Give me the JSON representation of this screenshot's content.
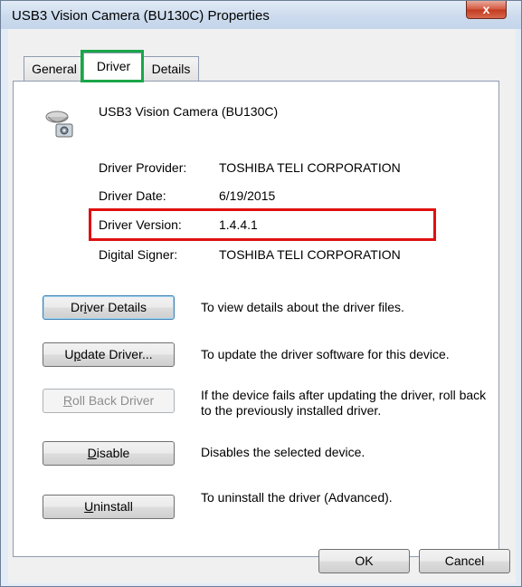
{
  "window": {
    "title": "USB3 Vision Camera (BU130C) Properties",
    "close_glyph": "x"
  },
  "tabs": [
    {
      "label": "General",
      "active": false
    },
    {
      "label": "Driver",
      "active": true
    },
    {
      "label": "Details",
      "active": false
    }
  ],
  "device": {
    "icon": "camera-icon",
    "name": "USB3 Vision Camera (BU130C)"
  },
  "info": {
    "provider_label": "Driver Provider:",
    "provider_value": "TOSHIBA TELI CORPORATION",
    "date_label": "Driver Date:",
    "date_value": "6/19/2015",
    "version_label": "Driver Version:",
    "version_value": "1.4.4.1",
    "signer_label": "Digital Signer:",
    "signer_value": "TOSHIBA TELI CORPORATION"
  },
  "actions": {
    "details": {
      "pre": "Dr",
      "key": "i",
      "post": "ver Details",
      "desc": "To view details about the driver files."
    },
    "update": {
      "pre": "U",
      "key": "p",
      "post": "date Driver...",
      "desc": "To update the driver software for this device."
    },
    "rollback": {
      "pre": "",
      "key": "R",
      "post": "oll Back Driver",
      "desc": "If the device fails after updating the driver, roll back to the previously installed driver."
    },
    "disable": {
      "pre": "",
      "key": "D",
      "post": "isable",
      "desc": "Disables the selected device."
    },
    "uninstall": {
      "pre": "",
      "key": "U",
      "post": "ninstall",
      "desc": "To uninstall the driver (Advanced)."
    }
  },
  "footer": {
    "ok_label": "OK",
    "cancel_label": "Cancel"
  },
  "colors": {
    "tab_highlight": "#1aa64a",
    "version_highlight": "#e01010"
  }
}
